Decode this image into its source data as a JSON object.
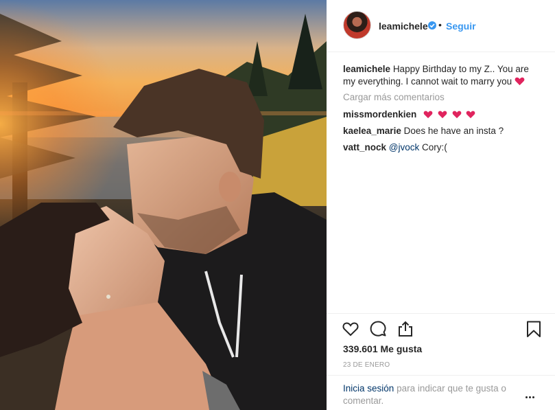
{
  "post": {
    "author": "leamichele",
    "verified": true,
    "separator": "•",
    "follow_label": "Seguir",
    "caption_author": "leamichele",
    "caption_text": "Happy Birthday to my Z.. You are my everything. I cannot wait to marry you",
    "caption_emoji": "red-heart-icon",
    "load_more_label": "Cargar más comentarios",
    "comments": [
      {
        "author": "missmordenkien",
        "text": "",
        "emoji": [
          "red-heart-icon",
          "red-heart-icon",
          "red-heart-icon",
          "red-heart-icon"
        ]
      },
      {
        "author": "kaelea_marie",
        "text": "Does he have an insta ?"
      },
      {
        "author": "vatt_nock",
        "mention": "@jvock",
        "text": "Cory:("
      }
    ],
    "likes_label": "339.601 Me gusta",
    "date_label": "23 DE ENERO",
    "login_link": "Inicia sesión",
    "login_text": "para indicar que te gusta o comentar.",
    "icons": {
      "like": "heart-outline-icon",
      "comment": "speech-bubble-icon",
      "share": "share-icon",
      "save": "bookmark-icon",
      "more": "more-options-icon",
      "verified": "verified-badge-icon"
    }
  },
  "colors": {
    "link_blue": "#3897f0",
    "text": "#262626",
    "muted": "#999999",
    "mention": "#003569",
    "heart_red": "#ed4956"
  }
}
